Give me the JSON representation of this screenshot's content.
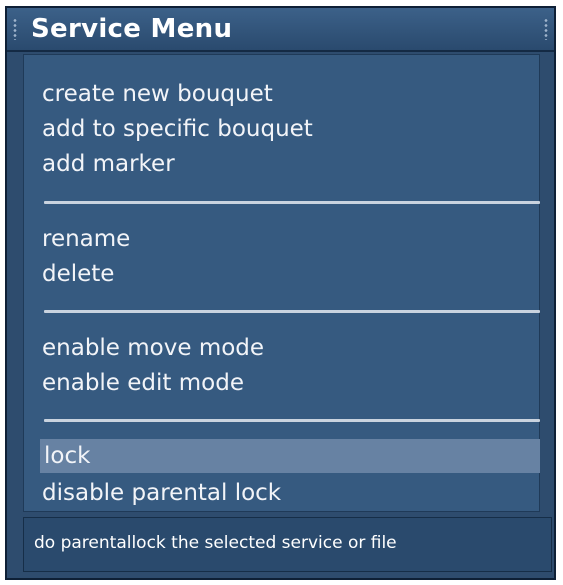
{
  "window": {
    "title": "Service Menu"
  },
  "menu": {
    "items": [
      {
        "label": "create new bouquet"
      },
      {
        "label": "add to specific bouquet"
      },
      {
        "label": "add marker"
      },
      {
        "label": "rename"
      },
      {
        "label": "delete"
      },
      {
        "label": "enable move mode"
      },
      {
        "label": "enable edit mode"
      },
      {
        "label": "lock",
        "selected": true
      },
      {
        "label": "disable parental lock"
      }
    ]
  },
  "status": {
    "text": "do parentallock the selected service or file"
  },
  "colors": {
    "window_bg": "#2e4c6e",
    "menu_bg": "#365a80",
    "selection_bg": "#6782a3",
    "separator": "#c9d3df",
    "text": "#f2f4f8"
  }
}
